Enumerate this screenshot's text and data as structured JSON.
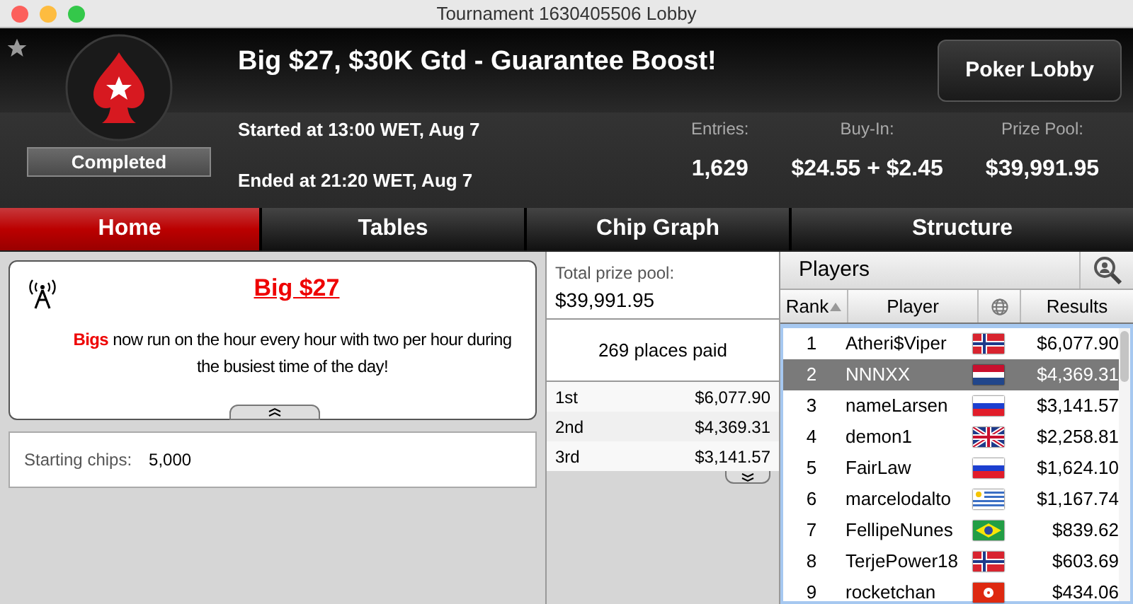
{
  "window": {
    "title": "Tournament 1630405506 Lobby"
  },
  "header": {
    "title": "Big $27, $30K Gtd - Guarantee Boost!",
    "status": "Completed",
    "started": "Started at 13:00 WET, Aug 7",
    "ended": "Ended at 21:20 WET, Aug 7",
    "button": "Poker Lobby",
    "stats": [
      {
        "label": "Entries:",
        "value": "1,629"
      },
      {
        "label": "Buy-In:",
        "value": "$24.55 + $2.45"
      },
      {
        "label": "Prize Pool:",
        "value": "$39,991.95"
      }
    ]
  },
  "tabs": [
    {
      "label": "Home",
      "selected": true
    },
    {
      "label": "Tables",
      "selected": false
    },
    {
      "label": "Chip Graph",
      "selected": false
    },
    {
      "label": "Structure",
      "selected": false
    }
  ],
  "news": {
    "title": "Big $27",
    "body": "**Bigs** now run on the hour every hour with two per hour during the busiest time of the day!"
  },
  "info": [
    {
      "label": "Starting chips:",
      "value": "5,000"
    }
  ],
  "prizes": {
    "total_label": "Total prize pool:",
    "total": "$39,991.95",
    "places": "269 places paid",
    "rows": [
      {
        "place": "1st",
        "amount": "$6,077.90"
      },
      {
        "place": "2nd",
        "amount": "$4,369.31"
      },
      {
        "place": "3rd",
        "amount": "$3,141.57"
      }
    ]
  },
  "players": {
    "title": "Players",
    "columns": [
      "Rank",
      "Player",
      "Results"
    ],
    "rows": [
      {
        "rank": "1",
        "name": "Atheri$Viper",
        "kind": "no",
        "result": "$6,077.90",
        "selected": false
      },
      {
        "rank": "2",
        "name": "NNNXX",
        "kind": "nl",
        "result": "$4,369.31",
        "selected": true
      },
      {
        "rank": "3",
        "name": "nameLarsen",
        "kind": "ru",
        "result": "$3,141.57",
        "selected": false
      },
      {
        "rank": "4",
        "name": "demon1",
        "kind": "gb",
        "result": "$2,258.81",
        "selected": false
      },
      {
        "rank": "5",
        "name": "FairLaw",
        "kind": "ru",
        "result": "$1,624.10",
        "selected": false
      },
      {
        "rank": "6",
        "name": "marcelodalto",
        "kind": "uy",
        "result": "$1,167.74",
        "selected": false
      },
      {
        "rank": "7",
        "name": "FellipeNunes",
        "kind": "br",
        "result": "$839.62",
        "selected": false
      },
      {
        "rank": "8",
        "name": "TerjePower18",
        "kind": "no",
        "result": "$603.69",
        "selected": false
      },
      {
        "rank": "9",
        "name": "rocketchan",
        "kind": "hk",
        "result": "$434.06",
        "selected": false
      }
    ]
  }
}
